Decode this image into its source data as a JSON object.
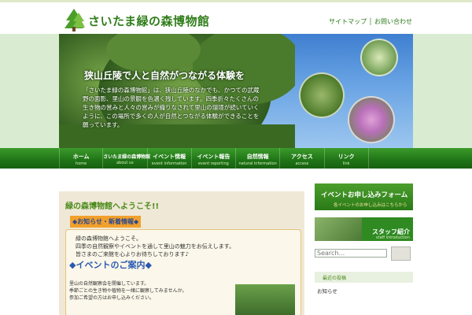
{
  "header": {
    "site_title": "さいたま緑の森博物館",
    "links": [
      "サイトマップ",
      "お問い合わせ"
    ]
  },
  "hero": {
    "headline": "狭山丘陵で人と自然がつながる体験を",
    "body": "「さいたま緑の森博物館」は、狭山丘陵のなかでも、かつての武蔵野の面影、里山の景観を色濃く残しています。四季折々たくさんの生き物の営みと人々の営みが織りなされて里山の環境が続いていくように、この場所で多くの人が自然とつながる体験ができることを願っています。"
  },
  "nav": [
    {
      "jp": "ホーム",
      "en": "home"
    },
    {
      "jp": "さいたま緑の森博物館",
      "en": "about us"
    },
    {
      "jp": "イベント情報",
      "en": "event information"
    },
    {
      "jp": "イベント報告",
      "en": "event reporting"
    },
    {
      "jp": "自然情報",
      "en": "natural information"
    },
    {
      "jp": "アクセス",
      "en": "access"
    },
    {
      "jp": "リンク",
      "en": "link"
    }
  ],
  "main": {
    "title": "緑の森博物館へようこそ!!",
    "badge": "◆お知らせ・新着情報◆",
    "greeting_lines": [
      "緑の森博物館へようこそ。",
      "四季の自然観察やイベントを通して里山の魅力をお伝えします。",
      "皆さまのご来館を心よりお待ちしております♪"
    ],
    "section_heading": "◆イベントのご案内◆",
    "event_lines": [
      "里山の自然観察会を開催しています。",
      "季節ごとの生き物や植物を一緒に観察してみませんか。",
      "参加ご希望の方はお申し込みください。"
    ]
  },
  "sidebar": {
    "banner_event_title": "イベントお申し込みフォーム",
    "banner_event_sub": "各イベントのお申し込みはこちらから",
    "banner_staff_title": "スタッフ紹介",
    "banner_staff_sub": "staff introduction",
    "search_placeholder": "Search...",
    "heading": "最近の投稿",
    "item": "お知らせ"
  },
  "colors": {
    "brand_green": "#2f7d1a",
    "nav_green": "#1f7416",
    "accent_orange": "#f2a02a",
    "heading_blue": "#2a5ab0"
  }
}
